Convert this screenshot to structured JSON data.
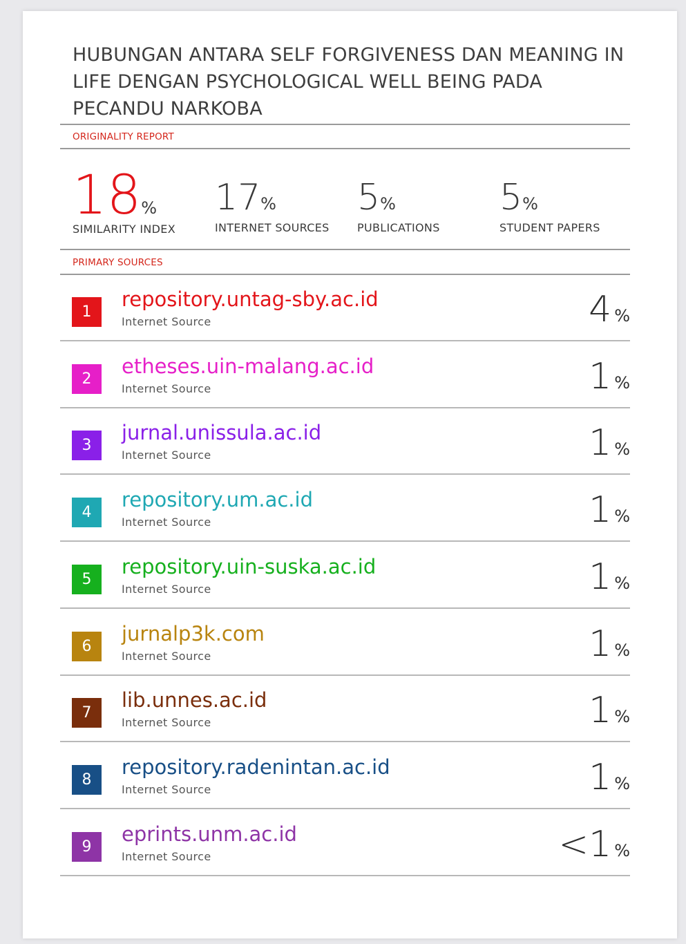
{
  "document": {
    "title": "HUBUNGAN ANTARA SELF FORGIVENESS DAN MEANING IN LIFE DENGAN PSYCHOLOGICAL WELL BEING PADA PECANDU NARKOBA",
    "originality_label": "ORIGINALITY REPORT",
    "primary_label": "PRIMARY SOURCES"
  },
  "stats": [
    {
      "value": "18",
      "unit": "%",
      "caption": "SIMILARITY INDEX"
    },
    {
      "value": "17",
      "unit": "%",
      "caption": "INTERNET SOURCES"
    },
    {
      "value": "5",
      "unit": "%",
      "caption": "PUBLICATIONS"
    },
    {
      "value": "5",
      "unit": "%",
      "caption": "STUDENT PAPERS"
    }
  ],
  "sources": [
    {
      "rank": "1",
      "name": "repository.untag-sby.ac.id",
      "type": "Internet Source",
      "share": "4",
      "unit": "%",
      "color": "#e3151a"
    },
    {
      "rank": "2",
      "name": "etheses.uin-malang.ac.id",
      "type": "Internet Source",
      "share": "1",
      "unit": "%",
      "color": "#e61fc8"
    },
    {
      "rank": "3",
      "name": "jurnal.unissula.ac.id",
      "type": "Internet Source",
      "share": "1",
      "unit": "%",
      "color": "#8a20e8"
    },
    {
      "rank": "4",
      "name": "repository.um.ac.id",
      "type": "Internet Source",
      "share": "1",
      "unit": "%",
      "color": "#1fa8b3"
    },
    {
      "rank": "5",
      "name": "repository.uin-suska.ac.id",
      "type": "Internet Source",
      "share": "1",
      "unit": "%",
      "color": "#16b01e"
    },
    {
      "rank": "6",
      "name": "jurnalp3k.com",
      "type": "Internet Source",
      "share": "1",
      "unit": "%",
      "color": "#b8840f"
    },
    {
      "rank": "7",
      "name": "lib.unnes.ac.id",
      "type": "Internet Source",
      "share": "1",
      "unit": "%",
      "color": "#7a2e0c"
    },
    {
      "rank": "8",
      "name": "repository.radenintan.ac.id",
      "type": "Internet Source",
      "share": "1",
      "unit": "%",
      "color": "#184f86"
    },
    {
      "rank": "9",
      "name": "eprints.unm.ac.id",
      "type": "Internet Source",
      "share": "<1",
      "unit": "%",
      "color": "#8e34a6"
    }
  ]
}
